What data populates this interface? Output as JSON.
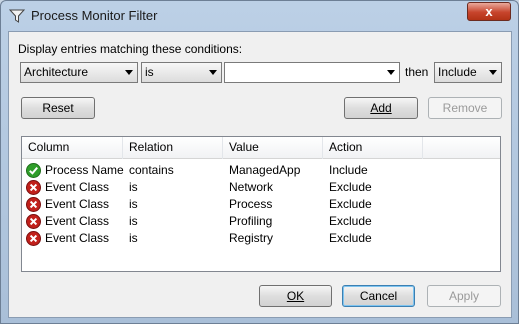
{
  "window": {
    "title": "Process Monitor Filter",
    "close_glyph": "x"
  },
  "conditions": {
    "prompt": "Display entries matching these conditions:",
    "column_value": "Architecture",
    "relation_value": "is",
    "value_text": "",
    "then_label": "then",
    "action_value": "Include"
  },
  "buttons": {
    "reset": "Reset",
    "add": "Add",
    "remove": "Remove",
    "ok": "OK",
    "cancel": "Cancel",
    "apply": "Apply"
  },
  "table": {
    "headers": [
      "Column",
      "Relation",
      "Value",
      "Action"
    ],
    "rows": [
      {
        "status": "check-icon",
        "column": "Process Name",
        "relation": "contains",
        "value": "ManagedApp",
        "action": "Include"
      },
      {
        "status": "exclude-icon",
        "column": "Event Class",
        "relation": "is",
        "value": "Network",
        "action": "Exclude"
      },
      {
        "status": "exclude-icon",
        "column": "Event Class",
        "relation": "is",
        "value": "Process",
        "action": "Exclude"
      },
      {
        "status": "exclude-icon",
        "column": "Event Class",
        "relation": "is",
        "value": "Profiling",
        "action": "Exclude"
      },
      {
        "status": "exclude-icon",
        "column": "Event Class",
        "relation": "is",
        "value": "Registry",
        "action": "Exclude"
      }
    ]
  },
  "colors": {
    "include_icon": "#2f9e2a",
    "exclude_icon": "#c1201b"
  }
}
